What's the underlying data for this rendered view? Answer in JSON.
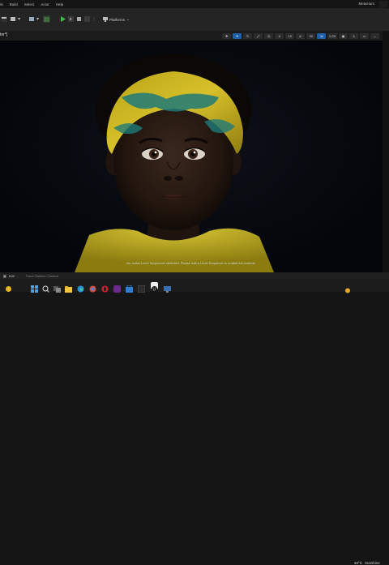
{
  "menu": {
    "items": [
      "ols",
      "Build",
      "Select",
      "Actor",
      "Help"
    ],
    "app_title": "MetaHum"
  },
  "toolbar": {
    "platforms_label": "Platforms",
    "icons": [
      "save-icon",
      "content-icon",
      "blueprint-icon",
      "cinematics-icon",
      "play-icon",
      "step-icon",
      "stop-icon",
      "eject-icon",
      "platforms-icon"
    ]
  },
  "viewport": {
    "title": "tor°]",
    "toolbar_values": {
      "fov": "90",
      "grid": "10",
      "scale": "0.25",
      "cams": "4"
    },
    "message": "No active Level Sequencer detected. Please edit a Level Sequence to enable full controls."
  },
  "bottom_bar": {
    "mode": "Drill",
    "trace": "Trace  Outliner  Content"
  },
  "taskbar": {
    "temperature": "34°C",
    "condition": "Sunshine",
    "apps": [
      "windows-icon",
      "search-icon",
      "task-view-icon",
      "file-explorer-icon",
      "edge-icon",
      "chrome-icon",
      "opera-icon",
      "spotify-icon",
      "store-icon",
      "terminal-icon",
      "epic-icon",
      "unreal-icon",
      "monitor-icon"
    ]
  },
  "colors": {
    "accent": "#1e5fa8",
    "play": "#3dbb4a",
    "headband_yellow": "#c9b21a",
    "headband_teal": "#1f7a78",
    "shirt_yellow": "#c9b62a",
    "skin": "#2b1c15"
  }
}
